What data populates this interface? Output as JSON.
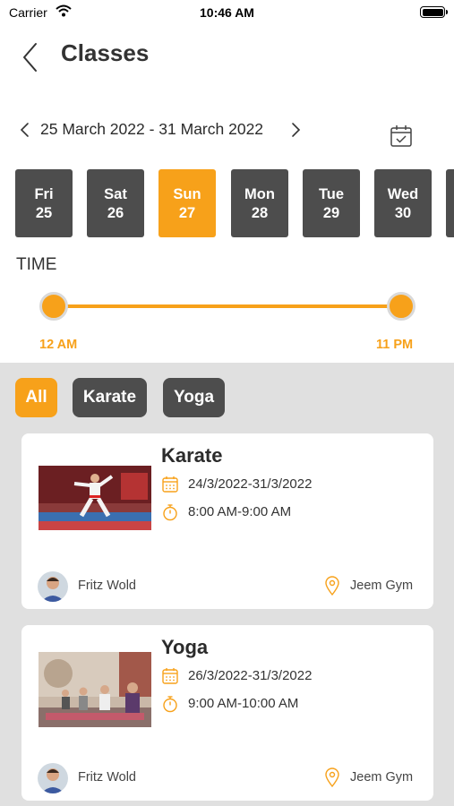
{
  "status": {
    "carrier": "Carrier",
    "time": "10:46 AM"
  },
  "nav": {
    "title": "Classes"
  },
  "week": {
    "range": "25 March 2022 - 31 March 2022"
  },
  "days": [
    {
      "name": "Fri",
      "num": "25",
      "selected": false
    },
    {
      "name": "Sat",
      "num": "26",
      "selected": false
    },
    {
      "name": "Sun",
      "num": "27",
      "selected": true
    },
    {
      "name": "Mon",
      "num": "28",
      "selected": false
    },
    {
      "name": "Tue",
      "num": "29",
      "selected": false
    },
    {
      "name": "Wed",
      "num": "30",
      "selected": false
    }
  ],
  "time_filter": {
    "label": "TIME",
    "min_label": "12 AM",
    "max_label": "11 PM"
  },
  "filters": [
    {
      "label": "All",
      "selected": true
    },
    {
      "label": "Karate",
      "selected": false
    },
    {
      "label": "Yoga",
      "selected": false
    }
  ],
  "classes": [
    {
      "title": "Karate",
      "dates": "24/3/2022-31/3/2022",
      "time": "8:00 AM-9:00 AM",
      "trainer": "Fritz Wold",
      "location": "Jeem Gym"
    },
    {
      "title": "Yoga",
      "dates": "26/3/2022-31/3/2022",
      "time": "9:00 AM-10:00 AM",
      "trainer": "Fritz Wold",
      "location": "Jeem Gym"
    }
  ],
  "colors": {
    "accent": "#f7a11a",
    "chip": "#4d4d4d",
    "list_bg": "#e0e0e0"
  }
}
